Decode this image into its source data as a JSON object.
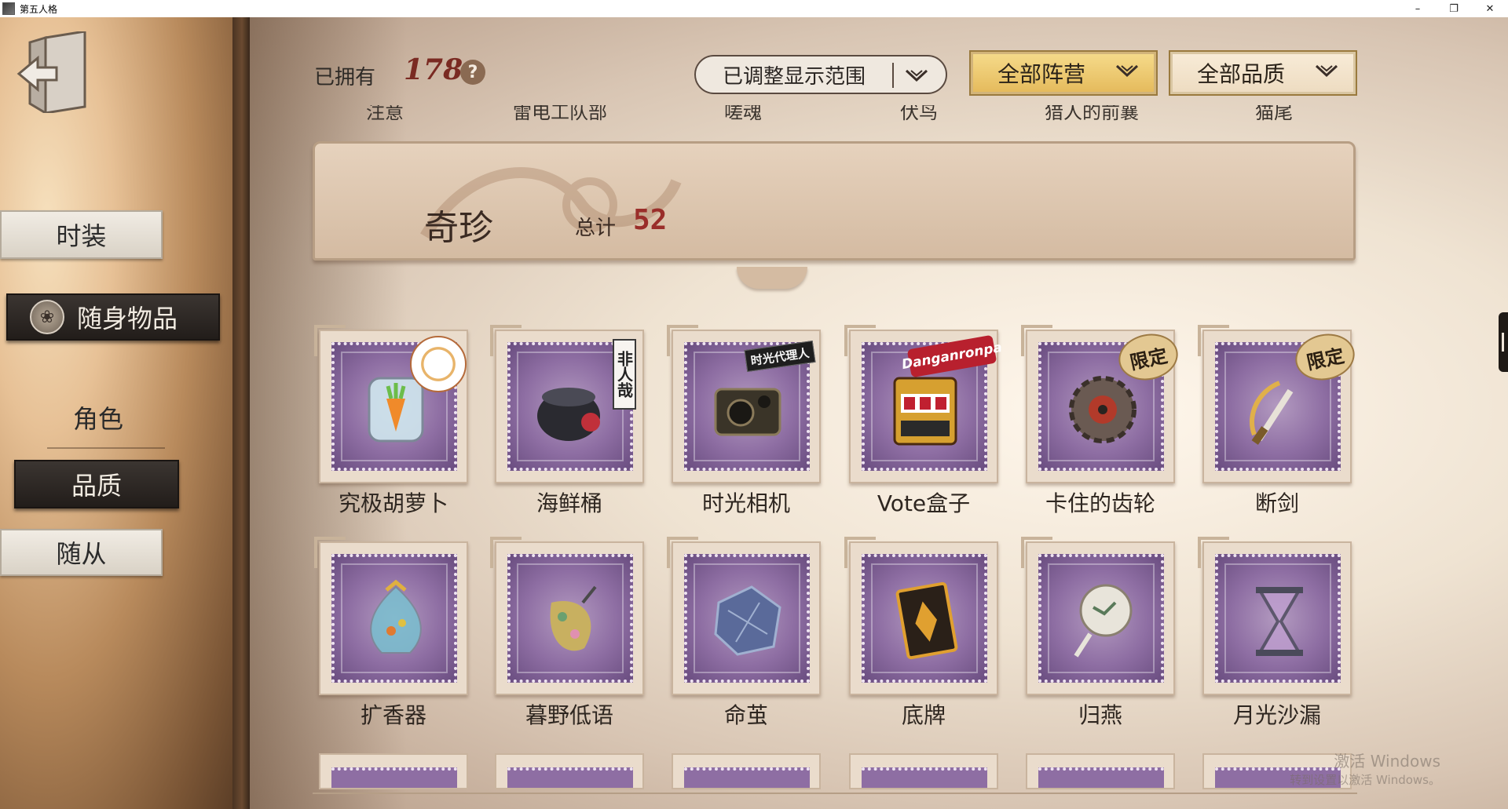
{
  "window": {
    "title": "第五人格",
    "minimize": "–",
    "maximize": "❐",
    "close": "✕"
  },
  "sidebar": {
    "back_icon": "exit-door-icon",
    "tabs": {
      "fashion": "时装",
      "items": "随身物品",
      "role": "角色",
      "quality": "品质",
      "follower": "随从"
    }
  },
  "header": {
    "owned_label": "已拥有",
    "owned_count": "178",
    "help": "?",
    "range_dropdown": "已调整显示范围",
    "camp_dropdown": "全部阵营",
    "quality_dropdown": "全部品质"
  },
  "cut_row": [
    "注意",
    "雷电工队部",
    "嗟魂",
    "伏鸟",
    "猎人的前襄",
    "猫尾"
  ],
  "category": {
    "title": "奇珍",
    "total_label": "总计",
    "total": "52"
  },
  "items": [
    {
      "name": "究极胡萝卜",
      "tag": "",
      "art": "carrot-jar-icon",
      "colors": [
        "#f08a2a",
        "#6cbd4a"
      ]
    },
    {
      "name": "海鲜桶",
      "tag": "非人哉",
      "art": "seafood-bucket-icon",
      "colors": [
        "#2a2a30",
        "#c0303a"
      ]
    },
    {
      "name": "时光相机",
      "tag": "时光代理人",
      "art": "camera-icon",
      "colors": [
        "#3a3428",
        "#8a7a5a"
      ]
    },
    {
      "name": "Vote盒子",
      "tag": "Danganronpa",
      "art": "slot-machine-icon",
      "colors": [
        "#d6a030",
        "#c02030"
      ]
    },
    {
      "name": "卡住的齿轮",
      "tag": "限定",
      "art": "gear-icon",
      "colors": [
        "#6a5a52",
        "#b23a2a"
      ]
    },
    {
      "name": "断剑",
      "tag": "限定",
      "art": "broken-sword-icon",
      "colors": [
        "#e0b04a",
        "#7a5a2a"
      ]
    },
    {
      "name": "扩香器",
      "tag": "",
      "art": "diffuser-icon",
      "colors": [
        "#7ac0d0",
        "#e0b040"
      ]
    },
    {
      "name": "暮野低语",
      "tag": "",
      "art": "whisper-lantern-icon",
      "colors": [
        "#c8b060",
        "#6aa070"
      ]
    },
    {
      "name": "命茧",
      "tag": "",
      "art": "cocoon-icon",
      "colors": [
        "#5a6a9a",
        "#a0b0d0"
      ]
    },
    {
      "name": "底牌",
      "tag": "",
      "art": "card-icon",
      "colors": [
        "#2a2018",
        "#e0a030"
      ]
    },
    {
      "name": "归燕",
      "tag": "",
      "art": "swallow-fan-icon",
      "colors": [
        "#e8e4da",
        "#5a7a5a"
      ]
    },
    {
      "name": "月光沙漏",
      "tag": "",
      "art": "hourglass-icon",
      "colors": [
        "#4a4a5a",
        "#c0a0d0"
      ]
    }
  ],
  "watermark": {
    "line1": "激活 Windows",
    "line2": "转到设置以激活 Windows。"
  }
}
